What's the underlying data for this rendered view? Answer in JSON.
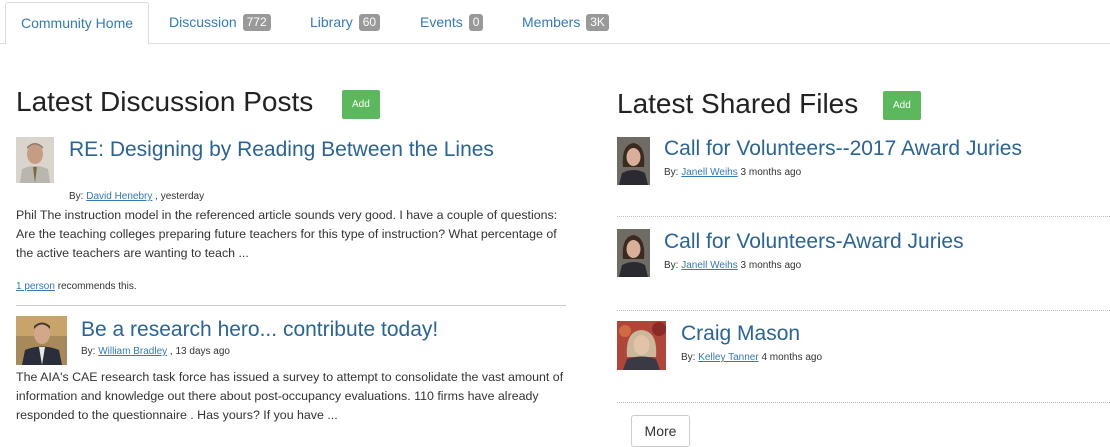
{
  "tabs": [
    {
      "label": "Community Home",
      "badge": null
    },
    {
      "label": "Discussion",
      "badge": "772"
    },
    {
      "label": "Library",
      "badge": "60"
    },
    {
      "label": "Events",
      "badge": "0"
    },
    {
      "label": "Members",
      "badge": "3K"
    }
  ],
  "discussion": {
    "title": "Latest Discussion Posts",
    "add_label": "Add",
    "posts": [
      {
        "title": "RE: Designing by Reading Between the Lines",
        "by_label": "By:",
        "author": "David Henebry",
        "time": ", yesterday",
        "body": "Phil The instruction model in the referenced article sounds very good. I have a couple of questions: Are the teaching colleges preparing future teachers for this type of instruction? What percentage of the active teachers are wanting to teach ...",
        "recommend_link": "1 person",
        "recommend_text": "recommends this."
      },
      {
        "title": "Be a research hero... contribute today!",
        "by_label": "By:",
        "author": "William Bradley",
        "time": ", 13 days ago",
        "body": "The AIA's CAE research task force has issued a survey to attempt to consolidate the vast amount of information and knowledge out there about post-occupancy evaluations.  110 firms have already responded to the questionnaire .  Has yours?  If you have ..."
      }
    ]
  },
  "files": {
    "title": "Latest Shared Files",
    "add_label": "Add",
    "items": [
      {
        "title": "Call for Volunteers--2017 Award Juries",
        "by_label": "By:",
        "author": "Janell Weihs",
        "time": "3 months ago"
      },
      {
        "title": "Call for Volunteers-Award Juries",
        "by_label": "By:",
        "author": "Janell Weihs",
        "time": "3 months ago"
      },
      {
        "title": "Craig Mason",
        "by_label": "By:",
        "author": "Kelley Tanner",
        "time": "4 months ago"
      }
    ],
    "more_label": "More"
  },
  "colors": {
    "link": "#337ab7",
    "add_button": "#5cb85c",
    "badge": "#999999"
  }
}
